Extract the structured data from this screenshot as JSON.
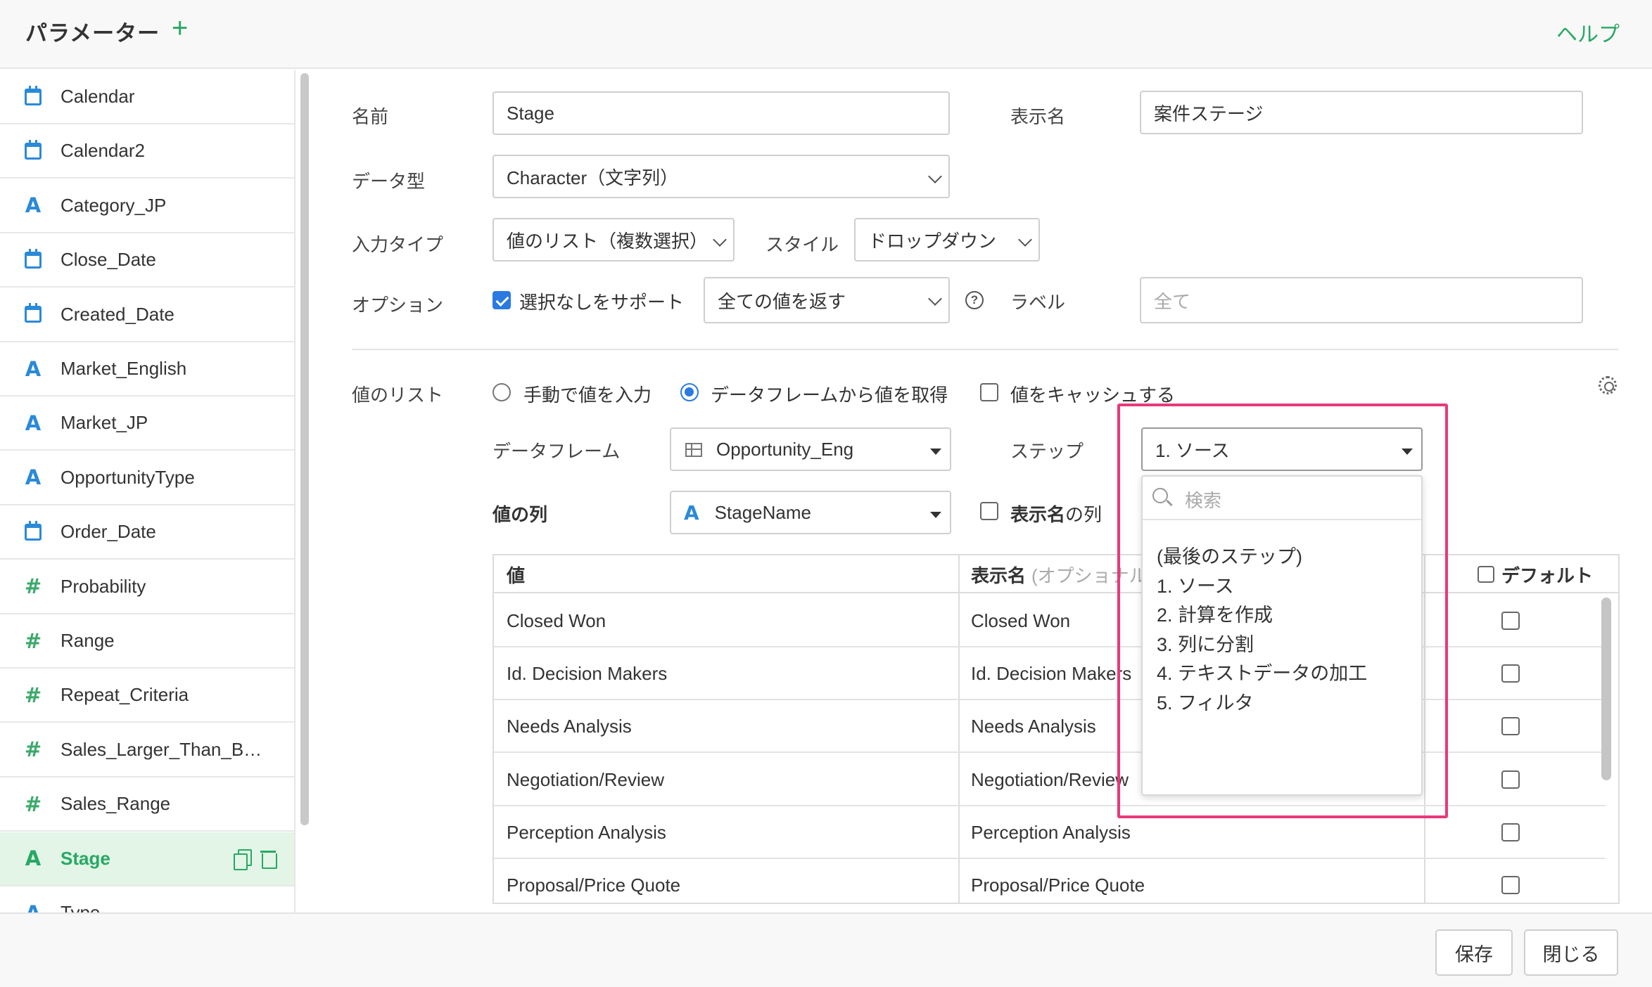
{
  "header": {
    "title": "パラメーター",
    "add_icon": "+",
    "help": "ヘルプ"
  },
  "sidebar": {
    "items": [
      {
        "label": "Calendar",
        "icon": "calendar-icon"
      },
      {
        "label": "Calendar2",
        "icon": "calendar-icon"
      },
      {
        "label": "Category_JP",
        "icon": "character-type-icon"
      },
      {
        "label": "Close_Date",
        "icon": "calendar-icon"
      },
      {
        "label": "Created_Date",
        "icon": "calendar-icon"
      },
      {
        "label": "Market_English",
        "icon": "character-type-icon"
      },
      {
        "label": "Market_JP",
        "icon": "character-type-icon"
      },
      {
        "label": "OpportunityType",
        "icon": "character-type-icon"
      },
      {
        "label": "Order_Date",
        "icon": "calendar-icon"
      },
      {
        "label": "Probability",
        "icon": "number-type-icon"
      },
      {
        "label": "Range",
        "icon": "number-type-icon"
      },
      {
        "label": "Repeat_Criteria",
        "icon": "number-type-icon"
      },
      {
        "label": "Sales_Larger_Than_B…",
        "icon": "number-type-icon"
      },
      {
        "label": "Sales_Range",
        "icon": "number-type-icon"
      },
      {
        "label": "Stage",
        "icon": "character-type-icon",
        "active": true
      },
      {
        "label": "Type",
        "icon": "character-type-icon"
      }
    ]
  },
  "form": {
    "name_label": "名前",
    "name_value": "Stage",
    "display_name_label": "表示名",
    "display_name_value": "案件ステージ",
    "data_type_label": "データ型",
    "data_type_value": "Character（文字列）",
    "input_type_label": "入力タイプ",
    "input_type_value": "値のリスト（複数選択）",
    "style_label": "スタイル",
    "style_value": "ドロップダウン",
    "option_label": "オプション",
    "support_none_label": "選択なしをサポート",
    "support_none_checked": true,
    "return_value": "全ての値を返す",
    "help_glyph": "?",
    "label_label": "ラベル",
    "label_placeholder": "全て"
  },
  "values_list": {
    "label": "値のリスト",
    "manual_label": "手動で値を入力",
    "from_df_label": "データフレームから値を取得",
    "cache_label": "値をキャッシュする",
    "selected_source": "from_dataframe",
    "dataframe_label": "データフレーム",
    "dataframe_value": "Opportunity_Eng",
    "step_label": "ステップ",
    "step_value": "1. ソース",
    "value_column_label": "値の列",
    "value_column_type_icon": "A",
    "value_column_value": "StageName",
    "display_column_label": "表示名",
    "display_column_suffix": "の列"
  },
  "table": {
    "col_value": "値",
    "col_display": "表示名",
    "col_display_hint": "(オプショナル)",
    "col_default": "デフォルト",
    "rows": [
      {
        "value": "Closed Won",
        "display": "Closed Won"
      },
      {
        "value": "Id. Decision Makers",
        "display": "Id. Decision Makers"
      },
      {
        "value": "Needs Analysis",
        "display": "Needs Analysis"
      },
      {
        "value": "Negotiation/Review",
        "display": "Negotiation/Review"
      },
      {
        "value": "Perception Analysis",
        "display": "Perception Analysis"
      },
      {
        "value": "Proposal/Price Quote",
        "display": "Proposal/Price Quote"
      }
    ]
  },
  "step_dropdown": {
    "search_placeholder": "検索",
    "options": [
      "(最後のステップ)",
      "1. ソース",
      "2. 計算を作成",
      "3. 列に分割",
      "4. テキストデータの加工",
      "5. フィルタ"
    ]
  },
  "footer": {
    "save": "保存",
    "close": "閉じる"
  },
  "colors": {
    "accent_green": "#28a864",
    "type_blue": "#2a8ad8",
    "highlight": "#e8397a",
    "check_blue": "#2a7ae2"
  }
}
